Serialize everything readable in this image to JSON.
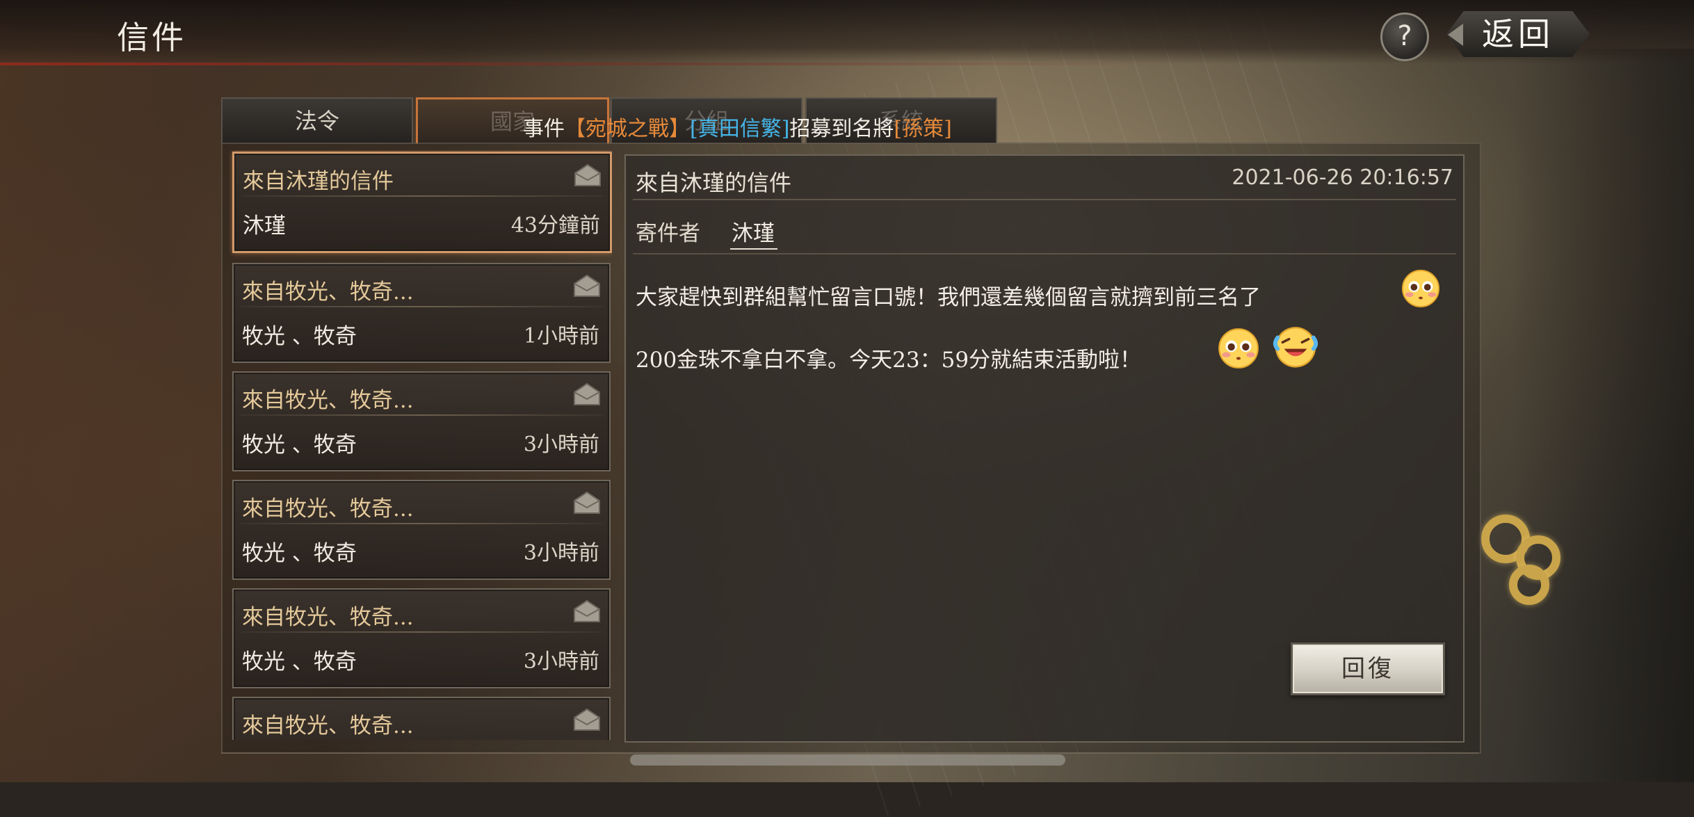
{
  "header": {
    "title": "信件",
    "help_label": "?",
    "back_label": "返回"
  },
  "tabs": [
    {
      "label": "法令"
    },
    {
      "label": "國家"
    },
    {
      "label": "分組"
    },
    {
      "label": "系統"
    }
  ],
  "ticker": {
    "part1": "事件",
    "part2": "【宛城之戰】",
    "part3": "[真田信繁]",
    "part4": "招募到名將",
    "part5": "[孫策]"
  },
  "mails": [
    {
      "title": "來自沐瑾的信件",
      "sender": "沐瑾",
      "time": "43分鐘前"
    },
    {
      "title": "來自牧光、牧奇...",
      "sender": "牧光 、牧奇",
      "time": "1小時前"
    },
    {
      "title": "來自牧光、牧奇...",
      "sender": "牧光 、牧奇",
      "time": "3小時前"
    },
    {
      "title": "來自牧光、牧奇...",
      "sender": "牧光 、牧奇",
      "time": "3小時前"
    },
    {
      "title": "來自牧光、牧奇...",
      "sender": "牧光 、牧奇",
      "time": "3小時前"
    },
    {
      "title": "來自牧光、牧奇...",
      "sender": "",
      "time": ""
    }
  ],
  "detail": {
    "title": "來自沐瑾的信件",
    "timestamp": "2021-06-26 20:16:57",
    "sender_label": "寄件者",
    "sender_name": "沐瑾",
    "line1": "大家趕快到群組幫忙留言口號！我們還差幾個留言就擠到前三名了",
    "line2": "200金珠不拿白不拿。今天23：59分就結束活動啦！",
    "reply_label": "回復"
  },
  "colors": {
    "accent_orange": "#e78a3a",
    "accent_blue": "#45b6e8",
    "selected_border": "#d39a6a"
  },
  "icons": [
    "help-icon",
    "back-arrow-icon",
    "envelope-icon",
    "blush-emoji-icon",
    "laughing-emoji-icon"
  ]
}
